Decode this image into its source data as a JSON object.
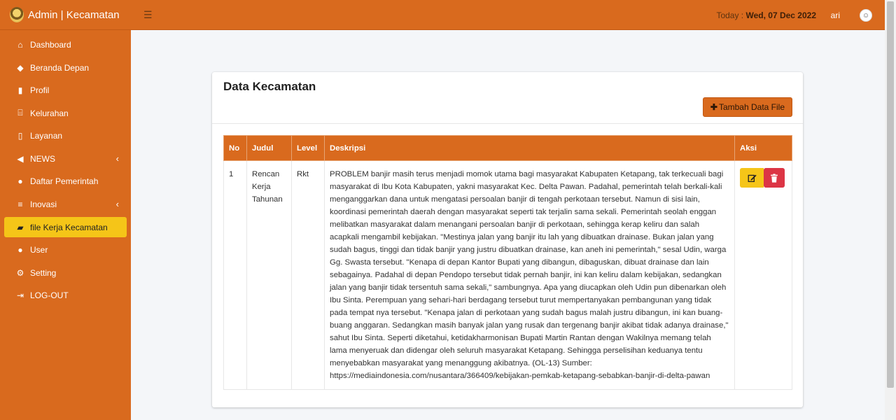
{
  "brand": {
    "title": "Admin | Kecamatan"
  },
  "sidebar": {
    "items": [
      {
        "label": "Dashboard",
        "icon": "home-icon"
      },
      {
        "label": "Beranda Depan",
        "icon": "tags-icon"
      },
      {
        "label": "Profil",
        "icon": "book-icon"
      },
      {
        "label": "Kelurahan",
        "icon": "institution-icon"
      },
      {
        "label": "Layanan",
        "icon": "file-icon"
      },
      {
        "label": "NEWS",
        "icon": "bullhorn-icon"
      },
      {
        "label": "Daftar Pemerintah",
        "icon": "users-icon"
      },
      {
        "label": "Inovasi",
        "icon": "list-icon"
      },
      {
        "label": "file Kerja Kecamatan",
        "icon": "folder-open-icon"
      },
      {
        "label": "User",
        "icon": "user-icon"
      },
      {
        "label": "Setting",
        "icon": "gear-icon"
      },
      {
        "label": "LOG-OUT",
        "icon": "sign-out-icon"
      }
    ]
  },
  "header": {
    "today_label": "Today :",
    "today_value": "Wed, 07 Dec 2022",
    "user_name": "ari"
  },
  "page": {
    "title": "Data Kecamatan",
    "add_button": "Tambah Data File"
  },
  "table": {
    "headers": [
      "No",
      "Judul",
      "Level",
      "Deskripsi",
      "Aksi"
    ],
    "rows": [
      {
        "no": "1",
        "judul": "Rencan Kerja Tahunan",
        "level": "Rkt",
        "deskripsi": "PROBLEM banjir masih terus menjadi momok utama bagi masyarakat Kabupaten Ketapang, tak terkecuali bagi masyarakat di Ibu Kota Kabupaten, yakni masyarakat Kec. Delta Pawan. Padahal, pemerintah telah berkali-kali menganggarkan dana untuk mengatasi persoalan banjir di tengah perkotaan tersebut. Namun di sisi lain, koordinasi pemerintah daerah dengan masyarakat seperti tak terjalin sama sekali. Pemerintah seolah enggan melibatkan masyarakat dalam menangani persoalan banjir di perkotaan, sehingga kerap keliru dan salah acapkali mengambil kebijakan. \"Mestinya jalan yang banjir itu lah yang dibuatkan drainase. Bukan jalan yang sudah bagus, tinggi dan tidak banjir yang justru dibuatkan drainase, kan aneh ini pemerintah,\" sesal Udin, warga Gg. Swasta tersebut. \"Kenapa di depan Kantor Bupati yang dibangun, dibaguskan, dibuat drainase dan lain sebagainya. Padahal di depan Pendopo tersebut tidak pernah banjir, ini kan keliru dalam kebijakan, sedangkan jalan yang banjir tidak tersentuh sama sekali,\" sambungnya. Apa yang diucapkan oleh Udin pun dibenarkan oleh Ibu Sinta. Perempuan yang sehari-hari berdagang tersebut turut mempertanyakan pembangunan yang tidak pada tempat nya tersebut. \"Kenapa jalan di perkotaan yang sudah bagus malah justru dibangun, ini kan buang-buang anggaran. Sedangkan masih banyak jalan yang rusak dan tergenang banjir akibat tidak adanya drainase,\" sahut Ibu Sinta. Seperti diketahui, ketidakharmonisan Bupati Martin Rantan dengan Wakilnya memang telah lama menyeruak dan didengar oleh seluruh masyarakat Ketapang. Sehingga perselisihan keduanya tentu menyebabkan masyarakat yang menanggung akibatnya. (OL-13) Sumber: https://mediaindonesia.com/nusantara/366409/kebijakan-pemkab-ketapang-sebabkan-banjir-di-delta-pawan"
      }
    ]
  },
  "colors": {
    "primary": "#d96a1e",
    "active": "#f5c518",
    "danger": "#dc3545"
  }
}
